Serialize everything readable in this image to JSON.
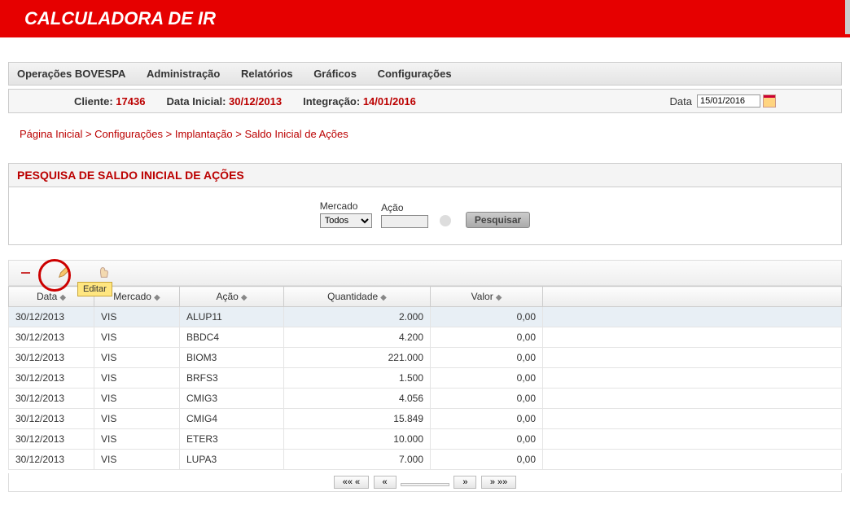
{
  "header": {
    "title": "CALCULADORA DE IR"
  },
  "nav": {
    "items": [
      "Operações BOVESPA",
      "Administração",
      "Relatórios",
      "Gráficos",
      "Configurações"
    ]
  },
  "info": {
    "cliente_label": "Cliente:",
    "cliente_value": "17436",
    "data_inicial_label": "Data Inicial:",
    "data_inicial_value": "30/12/2013",
    "integracao_label": "Integração:",
    "integracao_value": "14/01/2016",
    "data_label": "Data",
    "data_value": "15/01/2016"
  },
  "breadcrumb": {
    "items": [
      "Página Inicial",
      "Configurações",
      "Implantação",
      "Saldo Inicial de Ações"
    ],
    "sep": " > "
  },
  "panel": {
    "title": "PESQUISA DE SALDO INICIAL DE AÇÕES",
    "mercado_label": "Mercado",
    "mercado_value": "Todos",
    "acao_label": "Ação",
    "acao_value": "",
    "search_label": "Pesquisar"
  },
  "tooltip": {
    "editar": "Editar"
  },
  "grid": {
    "headers": {
      "data": "Data",
      "mercado": "Mercado",
      "acao": "Ação",
      "quantidade": "Quantidade",
      "valor": "Valor"
    },
    "rows": [
      {
        "data": "30/12/2013",
        "mercado": "VIS",
        "acao": "ALUP11",
        "quantidade": "2.000",
        "valor": "0,00"
      },
      {
        "data": "30/12/2013",
        "mercado": "VIS",
        "acao": "BBDC4",
        "quantidade": "4.200",
        "valor": "0,00"
      },
      {
        "data": "30/12/2013",
        "mercado": "VIS",
        "acao": "BIOM3",
        "quantidade": "221.000",
        "valor": "0,00"
      },
      {
        "data": "30/12/2013",
        "mercado": "VIS",
        "acao": "BRFS3",
        "quantidade": "1.500",
        "valor": "0,00"
      },
      {
        "data": "30/12/2013",
        "mercado": "VIS",
        "acao": "CMIG3",
        "quantidade": "4.056",
        "valor": "0,00"
      },
      {
        "data": "30/12/2013",
        "mercado": "VIS",
        "acao": "CMIG4",
        "quantidade": "15.849",
        "valor": "0,00"
      },
      {
        "data": "30/12/2013",
        "mercado": "VIS",
        "acao": "ETER3",
        "quantidade": "10.000",
        "valor": "0,00"
      },
      {
        "data": "30/12/2013",
        "mercado": "VIS",
        "acao": "LUPA3",
        "quantidade": "7.000",
        "valor": "0,00"
      }
    ]
  },
  "pager": {
    "first": "«« «",
    "prev": "«",
    "next": "»",
    "last": "» »»"
  }
}
